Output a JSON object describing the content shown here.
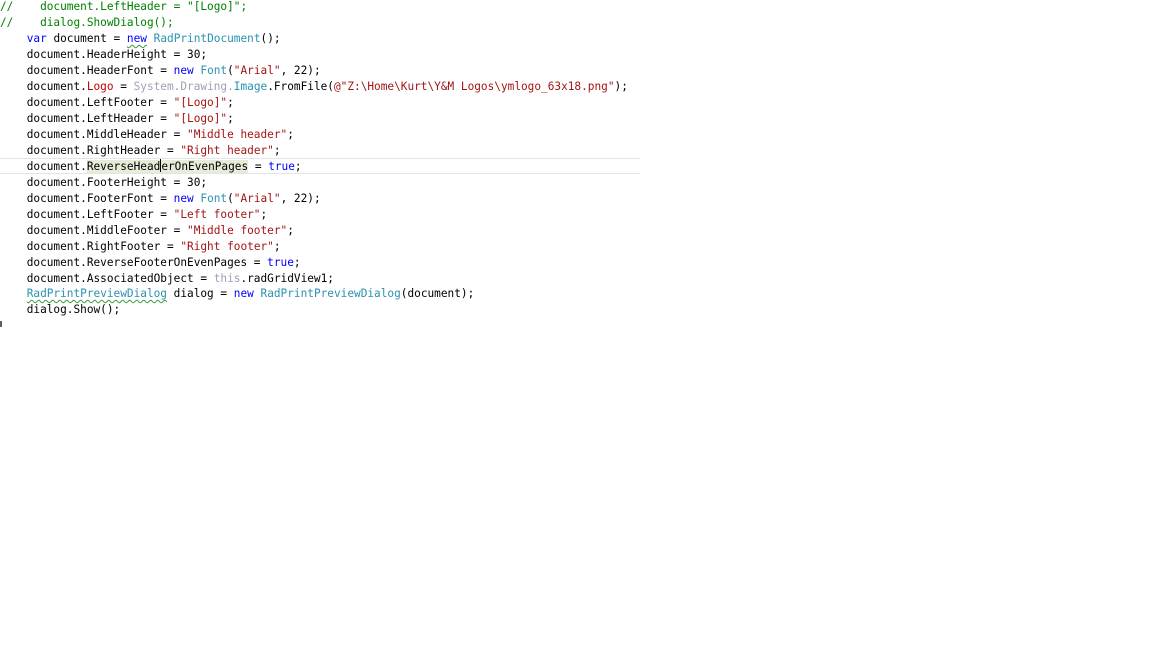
{
  "editor": {
    "lines": [
      [
        "//",
        "    document.LeftHeader = ",
        "\"[Logo]\"",
        ";"
      ],
      [
        "//",
        "    dialog.ShowDialog();"
      ],
      [
        "    ",
        "var",
        " document = ",
        "new",
        " ",
        "RadPrintDocument",
        "();"
      ],
      [
        "    document.HeaderHeight = 30;"
      ],
      [
        "    document.HeaderFont = ",
        "new",
        " ",
        "Font",
        "(",
        "\"Arial\"",
        ", 22);"
      ],
      [
        "    document.",
        "Logo",
        " = ",
        "System.Drawing.",
        "Image",
        ".FromFile(",
        "@\"Z:\\Home\\Kurt\\Y&M Logos\\ymlogo_63x18.png\"",
        ");"
      ],
      [
        "    document.LeftFooter = ",
        "\"[Logo]\"",
        ";"
      ],
      [
        "    document.LeftHeader = ",
        "\"[Logo]\"",
        ";"
      ],
      [
        "    document.MiddleHeader = ",
        "\"Middle header\"",
        ";"
      ],
      [
        "    document.RightHeader = ",
        "\"Right header\"",
        ";"
      ],
      [
        "    document.",
        "ReverseHead",
        "erOnEvenPages",
        " = ",
        "true",
        ";"
      ],
      [
        "    document.FooterHeight = 30;"
      ],
      [
        "    document.FooterFont = ",
        "new",
        " ",
        "Font",
        "(",
        "\"Arial\"",
        ", 22);"
      ],
      [
        "    document.LeftFooter = ",
        "\"Left footer\"",
        ";"
      ],
      [
        "    document.MiddleFooter = ",
        "\"Middle footer\"",
        ";"
      ],
      [
        "    document.RightFooter = ",
        "\"Right footer\"",
        ";"
      ],
      [
        "    document.ReverseFooterOnEvenPages = ",
        "true",
        ";"
      ],
      [
        "    document.AssociatedObject = ",
        "this",
        ".radGridView1;"
      ],
      [
        "    ",
        "RadPrintPreviewDialog",
        " dialog = ",
        "new",
        " ",
        "RadPrintPreviewDialog",
        "(document);"
      ],
      [
        "    dialog.Show();"
      ]
    ]
  }
}
